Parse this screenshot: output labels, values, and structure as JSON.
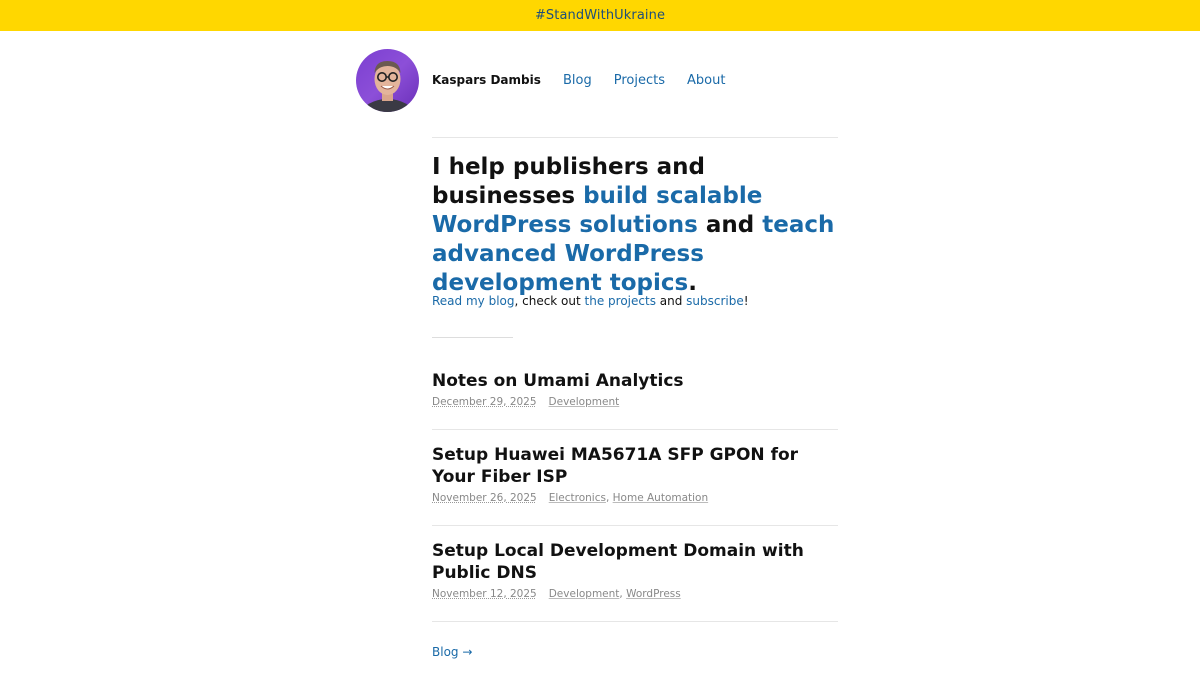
{
  "banner": {
    "text": "#StandWithUkraine"
  },
  "header": {
    "site_name": "Kaspars Dambis",
    "nav": [
      {
        "label": "Blog"
      },
      {
        "label": "Projects"
      },
      {
        "label": "About"
      }
    ]
  },
  "hero": {
    "p1": "I help publishers and businesses ",
    "h1": "build scalable WordPress solutions",
    "p2": " and ",
    "h2": "teach advanced WordPress development topics",
    "p3": "."
  },
  "intro": {
    "link1": "Read my blog",
    "t1": ", check out ",
    "link2": "the projects",
    "t2": " and ",
    "link3": "subscribe",
    "t3": "!"
  },
  "posts": [
    {
      "title": "Notes on Umami Analytics",
      "date": "December 29, 2025",
      "categories": [
        "Development"
      ]
    },
    {
      "title": "Setup Huawei MA5671A SFP GPON for Your Fiber ISP",
      "date": "November 26, 2025",
      "categories": [
        "Electronics",
        "Home Automation"
      ]
    },
    {
      "title": "Setup Local Development Domain with Public DNS",
      "date": "November 12, 2025",
      "categories": [
        "Development",
        "WordPress"
      ]
    }
  ],
  "footer_link": {
    "label": "Blog →"
  },
  "colors": {
    "banner_bg": "#ffd700",
    "link": "#1a6aa8",
    "text": "#111111",
    "meta": "#888888"
  }
}
